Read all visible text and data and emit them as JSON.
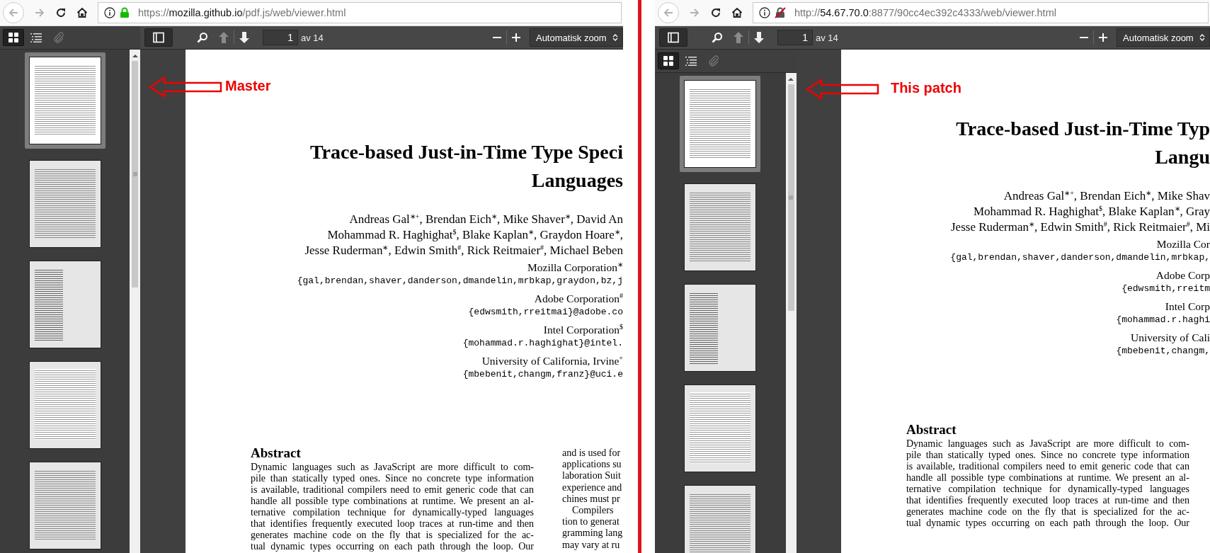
{
  "panes": [
    {
      "annotation": "Master",
      "secure": true,
      "url": {
        "scheme": "https://",
        "host": "mozilla.github.io",
        "rest": "/pdf.js/web/viewer.html"
      },
      "kind": "inline",
      "sidebar_buttons": [
        {
          "kind": "thumbnails",
          "selected": true,
          "disabled": false
        },
        {
          "kind": "outline",
          "selected": false,
          "disabled": false
        },
        {
          "kind": "attachments",
          "selected": false,
          "disabled": true
        }
      ],
      "page_number": "1",
      "page_count": "av 14",
      "zoom": "Automatisk zoom",
      "thumbnails": [
        {
          "selected": true
        },
        {
          "selected": false
        },
        {
          "selected": false
        },
        {
          "selected": false
        },
        {
          "selected": false
        }
      ],
      "document": {
        "title_lines": [
          "Trace-based Just-in-Time Type Speci",
          "Languages"
        ],
        "author_lines": [
          [
            {
              "text": "Andreas Gal",
              "sup": "∗+"
            },
            {
              "text": ", Brendan Eich",
              "sup": "∗"
            },
            {
              "text": ", Mike Shaver",
              "sup": "∗"
            },
            {
              "text": ", David An"
            }
          ],
          [
            {
              "text": "Mohammad R. Haghighat",
              "sup": "$"
            },
            {
              "text": ", Blake Kaplan",
              "sup": "∗"
            },
            {
              "text": ", Graydon Hoare",
              "sup": "∗"
            },
            {
              "text": ","
            }
          ],
          [
            {
              "text": "Jesse Ruderman",
              "sup": "∗"
            },
            {
              "text": ", Edwin Smith",
              "sup": "#"
            },
            {
              "text": ", Rick Reitmaier",
              "sup": "#"
            },
            {
              "text": ", Michael Beben"
            }
          ]
        ],
        "affiliations": [
          {
            "name": [
              {
                "text": "Mozilla Corporation",
                "sup": "∗"
              }
            ],
            "email": "{gal,brendan,shaver,danderson,dmandelin,mrbkap,graydon,bz,j"
          },
          {
            "name": [
              {
                "text": "Adobe Corporation",
                "sup": "#"
              }
            ],
            "email": "{edwsmith,rreitmai}@adobe.co"
          },
          {
            "name": [
              {
                "text": "Intel Corporation",
                "sup": "$"
              }
            ],
            "email": "{mohammad.r.haghighat}@intel."
          },
          {
            "name": [
              {
                "text": "University of California, Irvine",
                "sup": "+"
              }
            ],
            "email": "{mbebenit,changm,franz}@uci.e"
          }
        ],
        "abstract_heading": "Abstract",
        "abstract_lines": [
          "Dynamic languages such as JavaScript are more difficult to com-",
          "pile than statically typed ones. Since no concrete type information",
          "is available, traditional compilers need to emit generic code that can",
          "handle all possible type combinations at runtime. We present an al-",
          "ternative compilation technique for dynamically-typed languages",
          "that identifies frequently executed loop traces at run-time and then",
          "generates machine code on the fly that is specialized for the ac-",
          "tual dynamic types occurring on each path through the loop. Our"
        ],
        "side_lines": [
          {
            "text": "and is used for",
            "indent": false
          },
          {
            "text": "applications su",
            "indent": false
          },
          {
            "text": "laboration Suit",
            "indent": false
          },
          {
            "text": "experience and",
            "indent": false
          },
          {
            "text": "chines must pr",
            "indent": false
          },
          {
            "text": "Compilers",
            "indent": true
          },
          {
            "text": "tion to generat",
            "indent": false
          },
          {
            "text": "gramming lang",
            "indent": false
          },
          {
            "text": "may vary at ru",
            "indent": false
          }
        ]
      }
    },
    {
      "annotation": "This patch",
      "secure": false,
      "url": {
        "scheme": "http://",
        "host": "54.67.70.0",
        "rest": ":8877/90cc4ec392c4333/web/viewer.html"
      },
      "kind": "below",
      "sidebar_buttons": [
        {
          "kind": "thumbnails",
          "selected": true,
          "disabled": false
        },
        {
          "kind": "outline",
          "selected": false,
          "disabled": false
        },
        {
          "kind": "attachments",
          "selected": false,
          "disabled": true
        }
      ],
      "page_number": "1",
      "page_count": "av 14",
      "zoom": "Automatisk zoom",
      "thumbnails": [
        {
          "selected": true
        },
        {
          "selected": false
        },
        {
          "selected": false
        },
        {
          "selected": false
        },
        {
          "selected": false
        }
      ],
      "document": {
        "title_lines": [
          "Trace-based Just-in-Time Typ",
          "Langu"
        ],
        "author_lines": [
          [
            {
              "text": "Andreas Gal",
              "sup": "∗+"
            },
            {
              "text": ", Brendan Eich",
              "sup": "∗"
            },
            {
              "text": ", Mike Shav"
            }
          ],
          [
            {
              "text": "Mohammad R. Haghighat",
              "sup": "$"
            },
            {
              "text": ", Blake Kaplan",
              "sup": "∗"
            },
            {
              "text": ", Gray"
            }
          ],
          [
            {
              "text": "Jesse Ruderman",
              "sup": "∗"
            },
            {
              "text": ", Edwin Smith",
              "sup": "#"
            },
            {
              "text": ", Rick Reitmaier",
              "sup": "#"
            },
            {
              "text": ", Mi"
            }
          ]
        ],
        "affiliations": [
          {
            "name": [
              {
                "text": "Mozilla Cor"
              }
            ],
            "email": "{gal,brendan,shaver,danderson,dmandelin,mrbkap,"
          },
          {
            "name": [
              {
                "text": "Adobe Corp"
              }
            ],
            "email": "{edwsmith,rreitm"
          },
          {
            "name": [
              {
                "text": "Intel Corp"
              }
            ],
            "email": "{mohammad.r.haghi"
          },
          {
            "name": [
              {
                "text": "University of Cali"
              }
            ],
            "email": "{mbebenit,changm,"
          }
        ],
        "abstract_heading": "Abstract",
        "abstract_lines": [
          "Dynamic languages such as JavaScript are more difficult to com-",
          "pile than statically typed ones. Since no concrete type information",
          "is available, traditional compilers need to emit generic code that can",
          "handle all possible type combinations at runtime. We present an al-",
          "ternative compilation technique for dynamically-typed languages",
          "that identifies frequently executed loop traces at run-time and then",
          "generates machine code on the fly that is specialized for the ac-",
          "tual dynamic types occurring on each path through the loop. Our"
        ]
      }
    }
  ]
}
